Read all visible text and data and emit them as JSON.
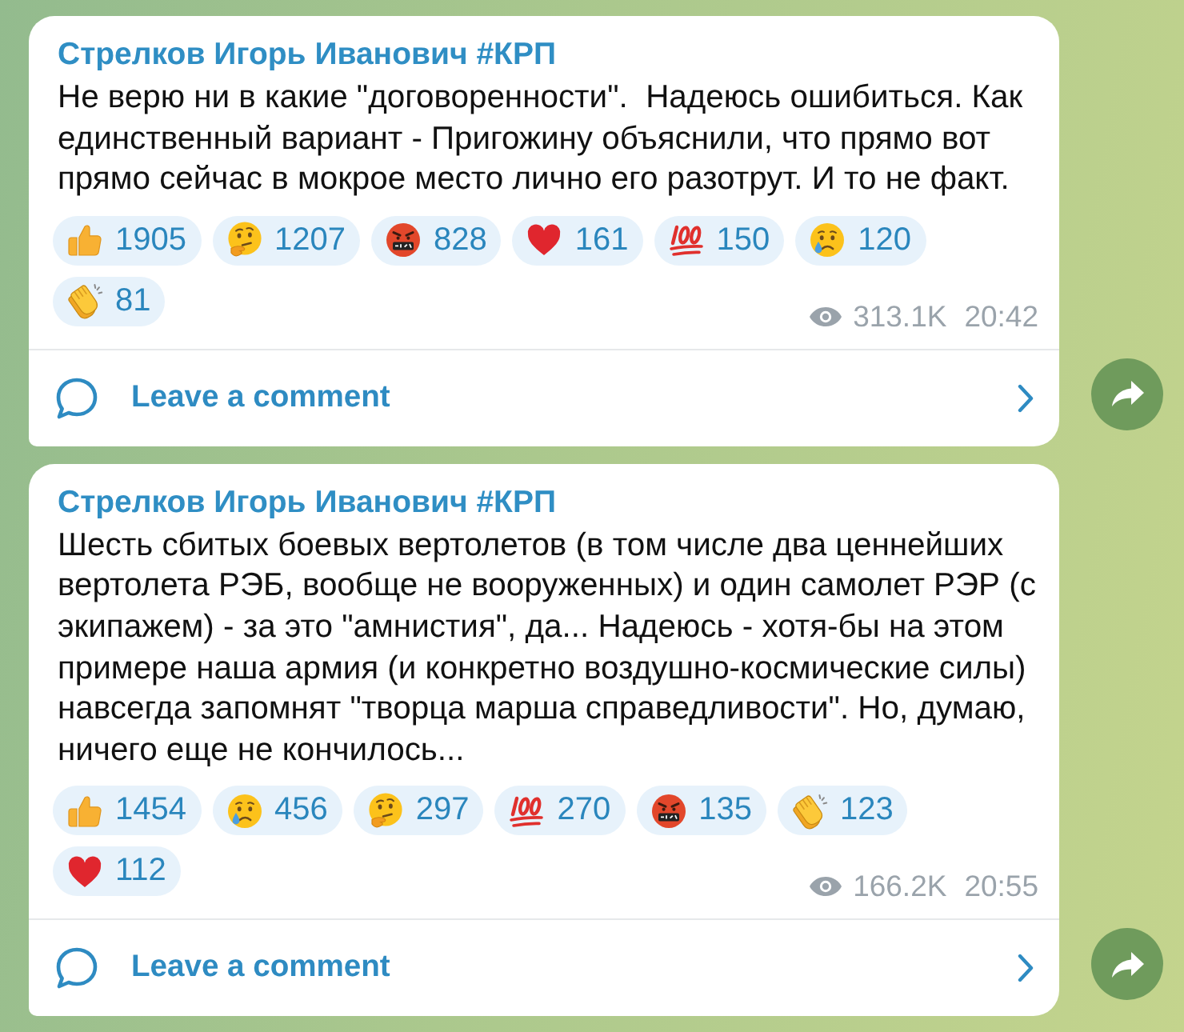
{
  "posts": [
    {
      "author": "Стрелков Игорь Иванович #КРП",
      "text": "Не верю ни в какие \"договоренности\".  Надеюсь ошибиться. Как единственный вариант - Пригожину объяснили, что прямо вот прямо сейчас в мокрое место лично его разотрут. И то не факт.",
      "reactions": [
        {
          "kind": "thumbs_up",
          "count": "1905"
        },
        {
          "kind": "thinking",
          "count": "1207"
        },
        {
          "kind": "cursing",
          "count": "828"
        },
        {
          "kind": "heart",
          "count": "161"
        },
        {
          "kind": "hundred",
          "count": "150"
        },
        {
          "kind": "crying",
          "count": "120"
        },
        {
          "kind": "clapping",
          "count": "81"
        }
      ],
      "views": "313.1K",
      "time": "20:42",
      "comment_link": "Leave a comment"
    },
    {
      "author": "Стрелков Игорь Иванович #КРП",
      "text": "Шесть сбитых боевых вертолетов (в том числе два ценнейших вертолета РЭБ, вообще не вооруженных) и один самолет РЭР (с экипажем) - за это \"амнистия\", да... Надеюсь - хотя-бы на этом примере наша армия (и конкретно воздушно-космические силы) навсегда запомнят \"творца марша справедливости\". Но, думаю, ничего еще не кончилось...",
      "reactions": [
        {
          "kind": "thumbs_up",
          "count": "1454"
        },
        {
          "kind": "crying",
          "count": "456"
        },
        {
          "kind": "thinking",
          "count": "297"
        },
        {
          "kind": "hundred",
          "count": "270"
        },
        {
          "kind": "cursing",
          "count": "135"
        },
        {
          "kind": "clapping",
          "count": "123"
        },
        {
          "kind": "heart",
          "count": "112"
        }
      ],
      "views": "166.2K",
      "time": "20:55",
      "comment_link": "Leave a comment"
    }
  ]
}
